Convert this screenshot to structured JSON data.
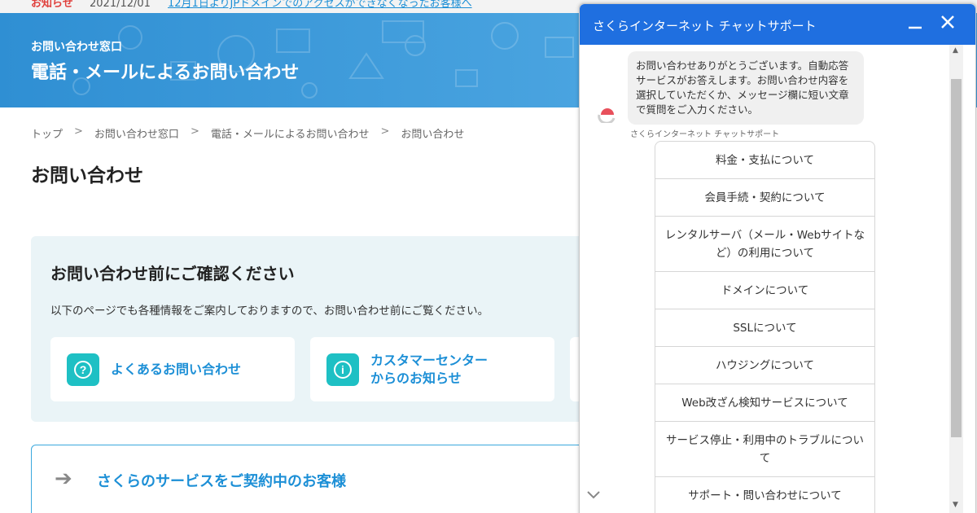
{
  "notice": {
    "label": "お知らせ",
    "date": "2021/12/01",
    "link": "12月1日よりJPドメインでのアクセスができなくなったお客様へ"
  },
  "hero": {
    "subtitle": "お問い合わせ窓口",
    "title": "電話・メールによるお問い合わせ"
  },
  "breadcrumb": [
    "トップ",
    "お問い合わせ窓口",
    "電話・メールによるお問い合わせ",
    "お問い合わせ"
  ],
  "breadcrumb_sep": ">",
  "page_title": "お問い合わせ",
  "confirm": {
    "title": "お問い合わせ前にご確認ください",
    "text": "以下のページでも各種情報をご案内しておりますので、お問い合わせ前にご覧ください。",
    "cards": [
      {
        "label": "よくあるお問い合わせ",
        "icon": "question-icon"
      },
      {
        "label": "カスタマーセンター\nからのお知らせ",
        "icon": "info-icon"
      }
    ]
  },
  "service": {
    "label": "さくらのサービスをご契約中のお客様"
  },
  "chat": {
    "title": "さくらインターネット チャットサポート",
    "message": "お問い合わせありがとうございます。自動応答サービスがお答えします。お問い合わせ内容を選択していただくか、メッセージ欄に短い文章で質問をご入力ください。",
    "sender": "さくらインターネット チャットサポート",
    "options": [
      "料金・支払について",
      "会員手続・契約について",
      "レンタルサーバ（メール・Webサイトなど）の利用について",
      "ドメインについて",
      "SSLについて",
      "ハウジングについて",
      "Web改ざん検知サービスについて",
      "サービス停止・利用中のトラブルについて",
      "サポート・問い合わせについて"
    ]
  },
  "colors": {
    "accent": "#1c8fd6",
    "chat_header": "#1f6fe0",
    "teal": "#1ec0c4",
    "notice_red": "#e0403c"
  }
}
